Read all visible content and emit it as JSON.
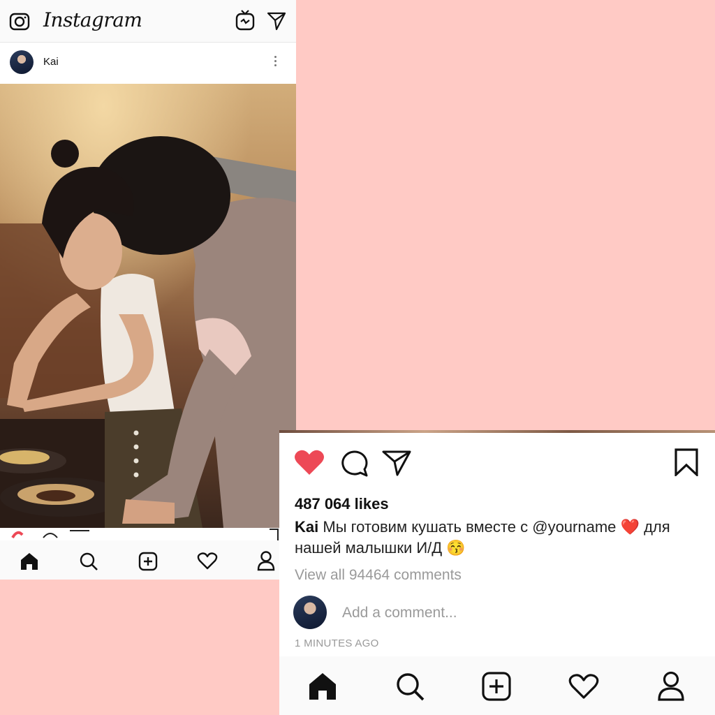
{
  "app": {
    "title": "Instagram",
    "icons": [
      "camera-icon",
      "igtv-icon",
      "direct-icon"
    ]
  },
  "post": {
    "username": "Kai",
    "likes": "487 064 likes",
    "caption_user": "Kai",
    "caption_text_1": "Мы готовим кушать вместе с",
    "mention": "@yourname",
    "caption_text_2": "для нашей малышки И/Д",
    "heart_emoji": "❤️",
    "kiss_emoji": "😚",
    "view_comments": "View all 94464 comments",
    "add_comment_placeholder": "Add a comment...",
    "time_ago": "1 MINUTES AGO",
    "liked": true
  },
  "nav": {
    "items": [
      "home-icon",
      "search-icon",
      "new-post-icon",
      "activity-icon",
      "profile-icon"
    ]
  },
  "colors": {
    "background": "#ffcac5",
    "like_red": "#ed4956",
    "text": "#111111",
    "muted": "#9a9a9a"
  }
}
